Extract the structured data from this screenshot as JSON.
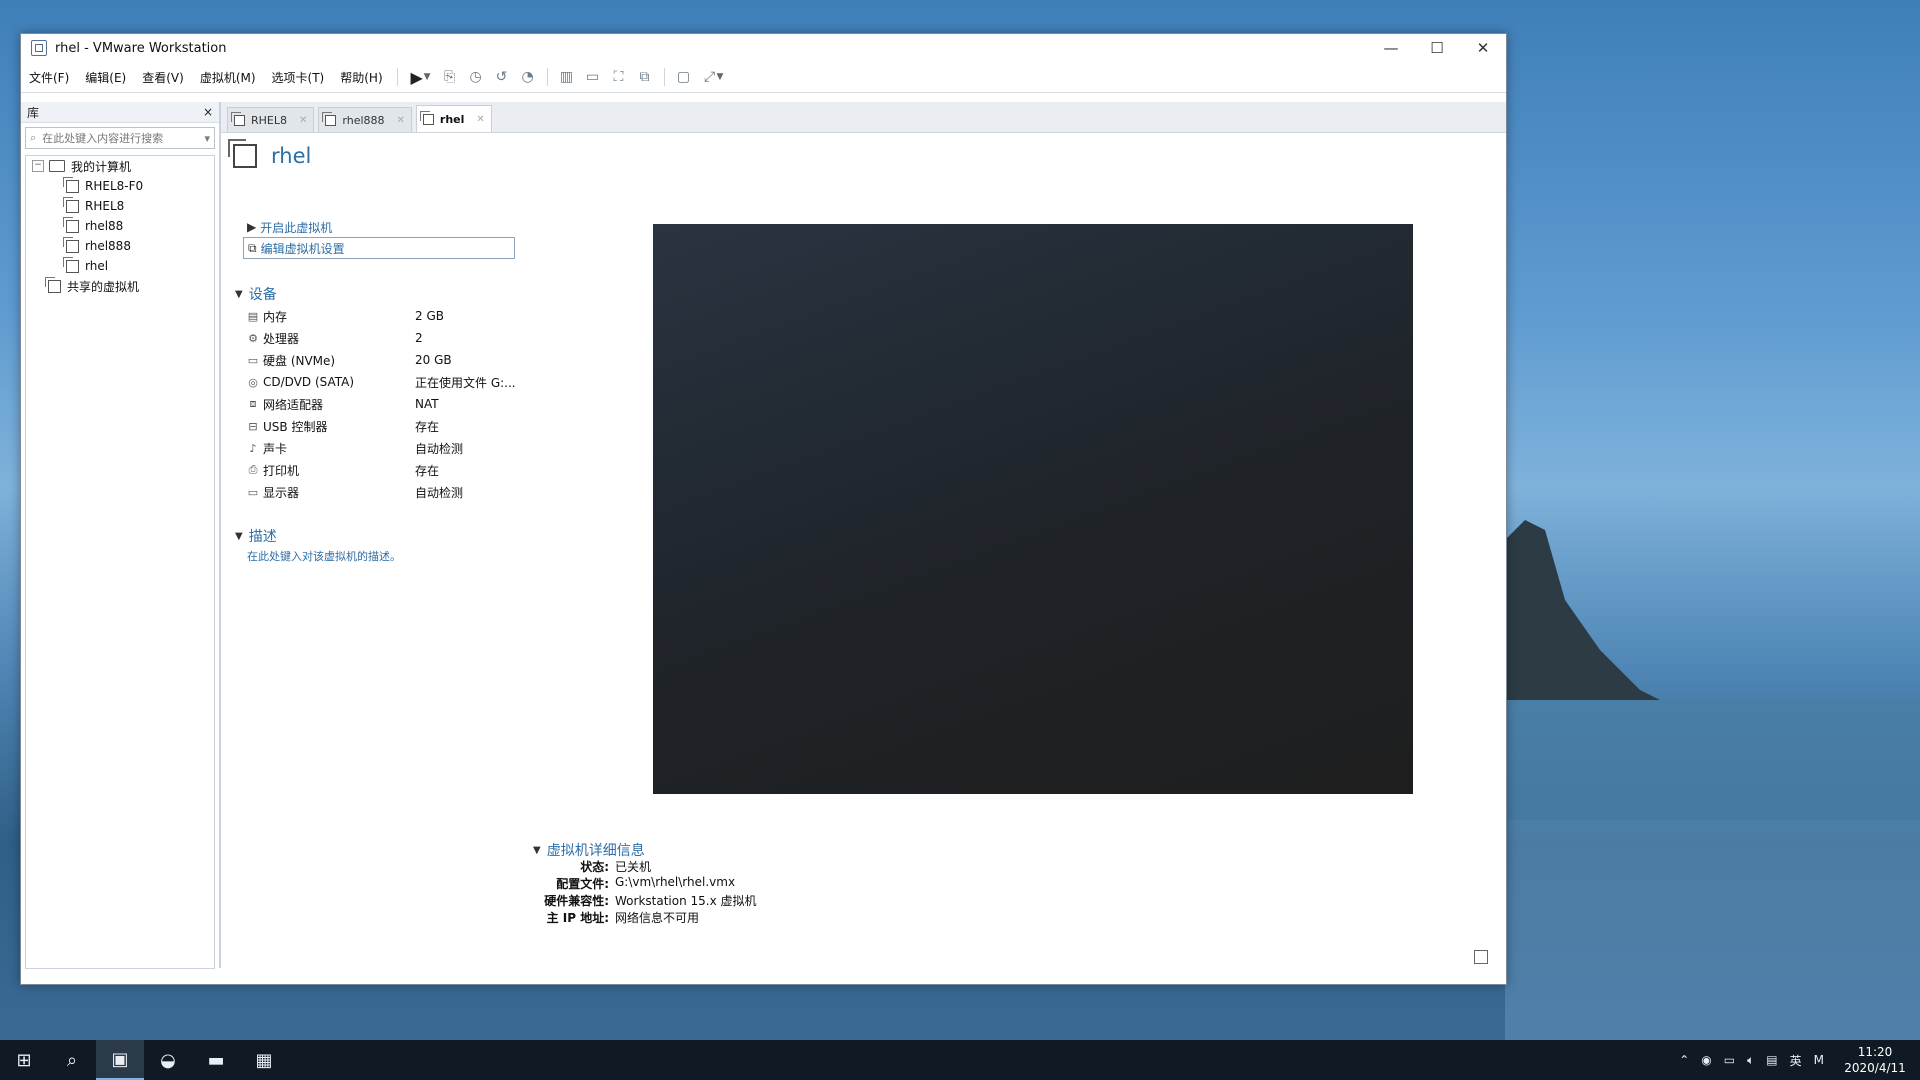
{
  "window": {
    "title": "rhel - VMware Workstation",
    "controls": {
      "minimize": "—",
      "maximize": "☐",
      "close": "✕"
    }
  },
  "menu": [
    "文件(F)",
    "编辑(E)",
    "查看(V)",
    "虚拟机(M)",
    "选项卡(T)",
    "帮助(H)"
  ],
  "library": {
    "title": "库",
    "close": "×",
    "search_placeholder": "在此处键入内容进行搜索",
    "tree": {
      "my_computer": "我的计算机",
      "vms": [
        "RHEL8-F0",
        "RHEL8",
        "rhel88",
        "rhel888",
        "rhel"
      ],
      "shared": "共享的虚拟机"
    }
  },
  "tabs": [
    {
      "label": "RHEL8",
      "active": false
    },
    {
      "label": "rhel888",
      "active": false
    },
    {
      "label": "rhel",
      "active": true
    }
  ],
  "vm": {
    "name": "rhel",
    "start_action": "开启此虚拟机",
    "edit_action": "编辑虚拟机设置"
  },
  "devices": {
    "header": "设备",
    "items": [
      {
        "icon": "memory-icon",
        "name": "内存",
        "value": "2 GB"
      },
      {
        "icon": "cpu-icon",
        "name": "处理器",
        "value": "2"
      },
      {
        "icon": "disk-icon",
        "name": "硬盘 (NVMe)",
        "value": "20 GB"
      },
      {
        "icon": "cd-icon",
        "name": "CD/DVD (SATA)",
        "value": "正在使用文件 G:..."
      },
      {
        "icon": "network-icon",
        "name": "网络适配器",
        "value": "NAT"
      },
      {
        "icon": "usb-icon",
        "name": "USB 控制器",
        "value": "存在"
      },
      {
        "icon": "sound-icon",
        "name": "声卡",
        "value": "自动检测"
      },
      {
        "icon": "printer-icon",
        "name": "打印机",
        "value": "存在"
      },
      {
        "icon": "display-icon",
        "name": "显示器",
        "value": "自动检测"
      }
    ]
  },
  "description": {
    "header": "描述",
    "placeholder": "在此处键入对该虚拟机的描述。"
  },
  "details": {
    "header": "虚拟机详细信息",
    "rows": [
      {
        "key": "状态:",
        "value": "已关机"
      },
      {
        "key": "配置文件:",
        "value": "G:\\vm\\rhel\\rhel.vmx"
      },
      {
        "key": "硬件兼容性:",
        "value": "Workstation 15.x 虚拟机"
      },
      {
        "key": "主 IP 地址:",
        "value": "网络信息不可用"
      }
    ]
  },
  "taskbar": {
    "tray_lang": "英",
    "tray_ime": "M",
    "time": "11:20",
    "date": "2020/4/11"
  }
}
